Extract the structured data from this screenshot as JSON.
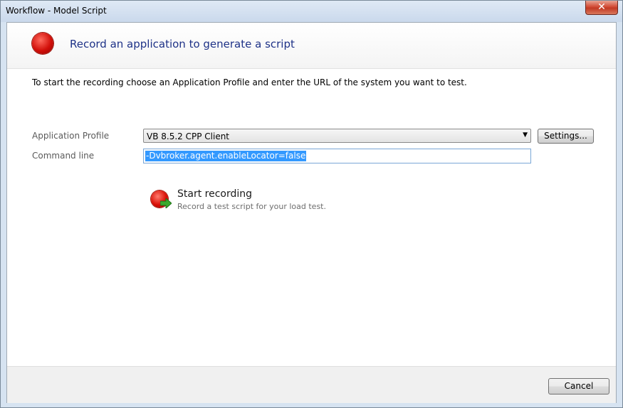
{
  "window": {
    "title": "Workflow - Model Script",
    "close_glyph": "✕"
  },
  "header": {
    "title": "Record an application to generate a script",
    "icon": "stop-record-icon",
    "icon_color": "#d2100a"
  },
  "instruction": "To start the recording choose an Application Profile and enter the URL of the system you want to test.",
  "form": {
    "app_profile_label": "Application Profile",
    "app_profile_value": "VB 8.5.2 CPP Client",
    "settings_label": "Settings...",
    "command_line_label": "Command line",
    "command_line_value": "-Dvbroker.agent.enableLocator=false"
  },
  "start_recording": {
    "title": "Start recording",
    "subtitle": "Record a test script for your load test.",
    "icon": "record-icon"
  },
  "footer": {
    "cancel_label": "Cancel"
  },
  "colors": {
    "header_title": "#1e3287",
    "selection": "#3399ff",
    "close_button": "#c23a24"
  }
}
